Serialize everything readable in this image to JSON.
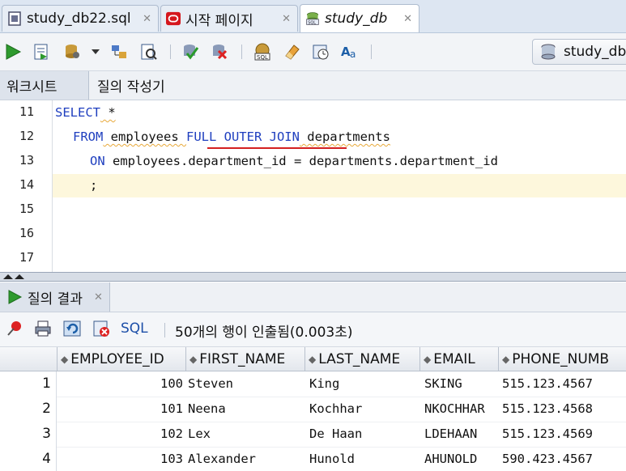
{
  "doc_tabs": [
    {
      "label": "study_db22.sql",
      "icon": "sql-file-icon"
    },
    {
      "label": "시작 페이지",
      "icon": "oracle-icon"
    },
    {
      "label": "study_db",
      "icon": "sql-worksheet-icon"
    }
  ],
  "toolbar": {
    "connection_label": "study_db"
  },
  "sub_tabs": [
    "워크시트",
    "질의 작성기"
  ],
  "editor": {
    "line_numbers": [
      "11",
      "12",
      "13",
      "14",
      "15",
      "16",
      "17"
    ],
    "lines": [
      {
        "kw1": "SELECT",
        "rest1": " *"
      },
      {
        "kw1": "FROM",
        "t1": " employees ",
        "kw2": "FULL OUTER JOIN",
        "t2": " departments"
      },
      {
        "kw1": "ON",
        "t1": " employees.department_id = departments.department_id"
      },
      {
        "t1": ";"
      }
    ]
  },
  "result": {
    "tab_label": "질의 결과",
    "sql_label": "SQL",
    "status": "50개의 행이 인출됨(0.003초)",
    "columns": [
      "EMPLOYEE_ID",
      "FIRST_NAME",
      "LAST_NAME",
      "EMAIL",
      "PHONE_NUMB"
    ],
    "rows": [
      {
        "n": "1",
        "employee_id": "100",
        "first_name": "Steven",
        "last_name": "King",
        "email": "SKING",
        "phone": "515.123.4567"
      },
      {
        "n": "2",
        "employee_id": "101",
        "first_name": "Neena",
        "last_name": "Kochhar",
        "email": "NKOCHHAR",
        "phone": "515.123.4568"
      },
      {
        "n": "3",
        "employee_id": "102",
        "first_name": "Lex",
        "last_name": "De Haan",
        "email": "LDEHAAN",
        "phone": "515.123.4569"
      },
      {
        "n": "4",
        "employee_id": "103",
        "first_name": "Alexander",
        "last_name": "Hunold",
        "email": "AHUNOLD",
        "phone": "590.423.4567"
      }
    ]
  }
}
